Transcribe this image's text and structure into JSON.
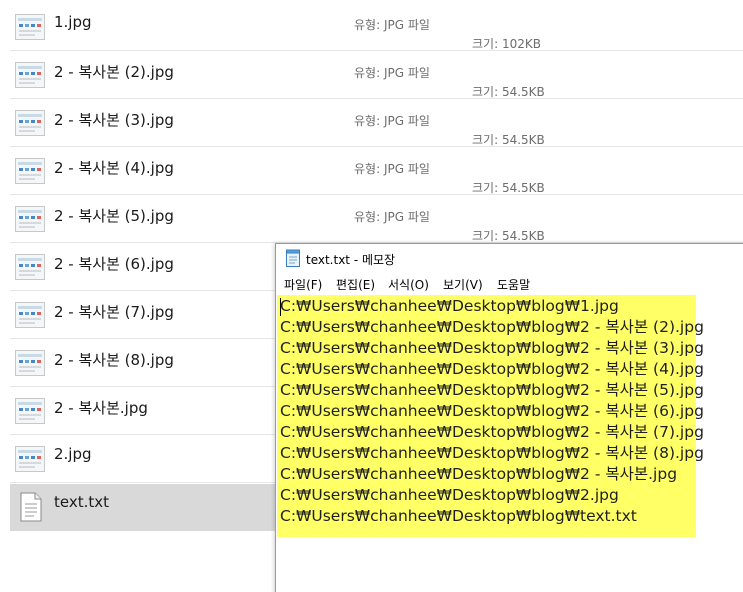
{
  "explorer": {
    "files": [
      {
        "name": "1.jpg",
        "icon": "image-thumbnail-icon",
        "type": "유형: JPG 파일",
        "size": "크기: 102KB"
      },
      {
        "name": "2 - 복사본 (2).jpg",
        "icon": "image-thumbnail-icon",
        "type": "유형: JPG 파일",
        "size": "크기: 54.5KB"
      },
      {
        "name": "2 - 복사본 (3).jpg",
        "icon": "image-thumbnail-icon",
        "type": "유형: JPG 파일",
        "size": "크기: 54.5KB"
      },
      {
        "name": "2 - 복사본 (4).jpg",
        "icon": "image-thumbnail-icon",
        "type": "유형: JPG 파일",
        "size": "크기: 54.5KB"
      },
      {
        "name": "2 - 복사본 (5).jpg",
        "icon": "image-thumbnail-icon",
        "type": "유형: JPG 파일",
        "size": "크기: 54.5KB"
      },
      {
        "name": "2 - 복사본 (6).jpg",
        "icon": "image-thumbnail-icon"
      },
      {
        "name": "2 - 복사본 (7).jpg",
        "icon": "image-thumbnail-icon"
      },
      {
        "name": "2 - 복사본 (8).jpg",
        "icon": "image-thumbnail-icon"
      },
      {
        "name": "2 - 복사본.jpg",
        "icon": "image-thumbnail-icon"
      },
      {
        "name": "2.jpg",
        "icon": "image-thumbnail-icon"
      },
      {
        "name": "text.txt",
        "icon": "text-document-icon",
        "selected": true
      }
    ]
  },
  "notepad": {
    "title": "text.txt - 메모장",
    "title_icon": "notepad-icon",
    "menu": [
      "파일(F)",
      "편집(E)",
      "서식(O)",
      "보기(V)",
      "도움말"
    ],
    "highlight_color": "#ffff66",
    "lines": [
      "C:\\Users\\chanhee\\Desktop\\blog\\1.jpg",
      "C:\\Users\\chanhee\\Desktop\\blog\\2 - 복사본 (2).jpg",
      "C:\\Users\\chanhee\\Desktop\\blog\\2 - 복사본 (3).jpg",
      "C:\\Users\\chanhee\\Desktop\\blog\\2 - 복사본 (4).jpg",
      "C:\\Users\\chanhee\\Desktop\\blog\\2 - 복사본 (5).jpg",
      "C:\\Users\\chanhee\\Desktop\\blog\\2 - 복사본 (6).jpg",
      "C:\\Users\\chanhee\\Desktop\\blog\\2 - 복사본 (7).jpg",
      "C:\\Users\\chanhee\\Desktop\\blog\\2 - 복사본 (8).jpg",
      "C:\\Users\\chanhee\\Desktop\\blog\\2 - 복사본.jpg",
      "C:\\Users\\chanhee\\Desktop\\blog\\2.jpg",
      "C:\\Users\\chanhee\\Desktop\\blog\\text.txt"
    ]
  },
  "colors": {
    "selected_row": "#d9d9d9",
    "meta_text": "#6d6d6d"
  }
}
